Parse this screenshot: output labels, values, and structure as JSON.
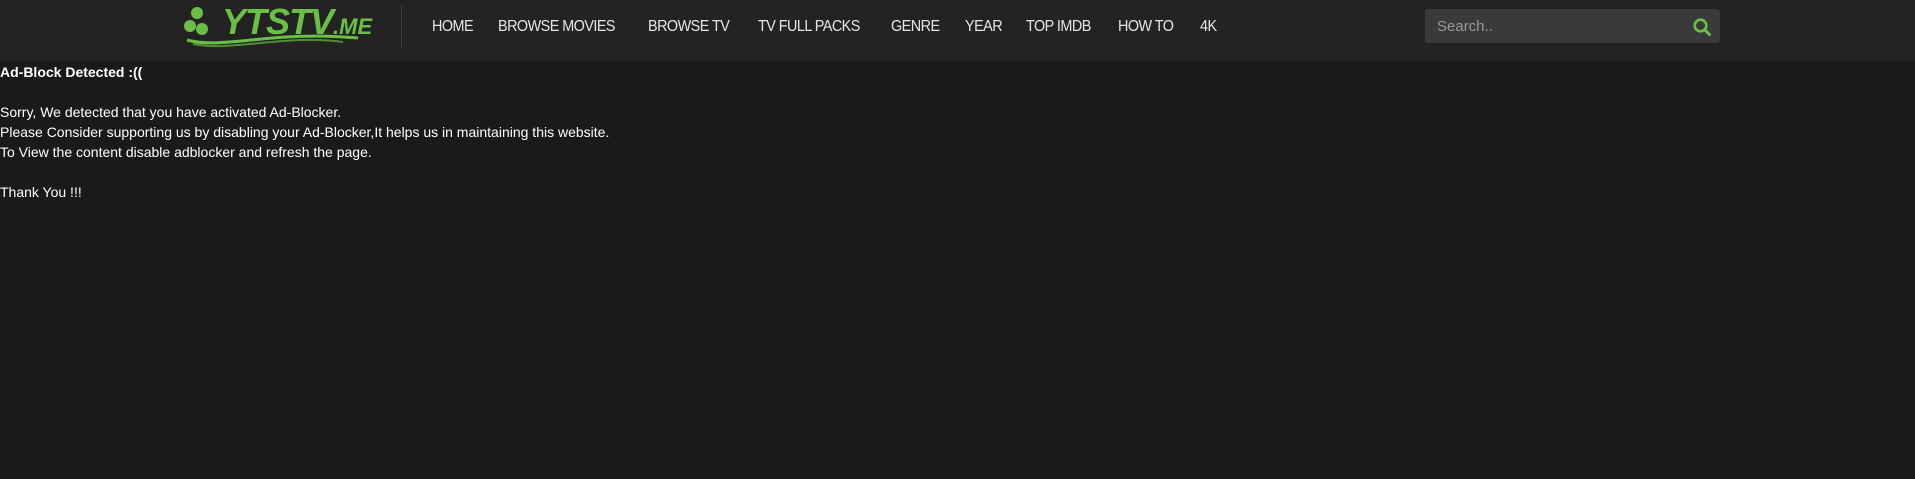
{
  "brand": {
    "name": "YTSTV",
    "tld": ".ME",
    "accent_color": "#6ac045"
  },
  "nav": {
    "items": [
      {
        "label": "HOME"
      },
      {
        "label": "BROWSE MOVIES"
      },
      {
        "label": "BROWSE TV"
      },
      {
        "label": "TV FULL PACKS"
      },
      {
        "label": "GENRE"
      },
      {
        "label": "YEAR"
      },
      {
        "label": "TOP IMDB"
      },
      {
        "label": "HOW TO"
      },
      {
        "label": "4K"
      }
    ]
  },
  "search": {
    "placeholder": "Search..",
    "value": "",
    "icon": "search-icon"
  },
  "notice": {
    "heading": "Ad-Block Detected :((",
    "line1": "Sorry, We detected that you have activated Ad-Blocker.",
    "line2": "Please Consider supporting us by disabling your Ad-Blocker,It helps us in maintaining this website.",
    "line3": "To View the content disable adblocker and refresh the page.",
    "closing": "Thank You !!!"
  },
  "colors": {
    "background": "#1a1a1a",
    "header": "#232323",
    "search_bg": "#3a3a3a"
  }
}
